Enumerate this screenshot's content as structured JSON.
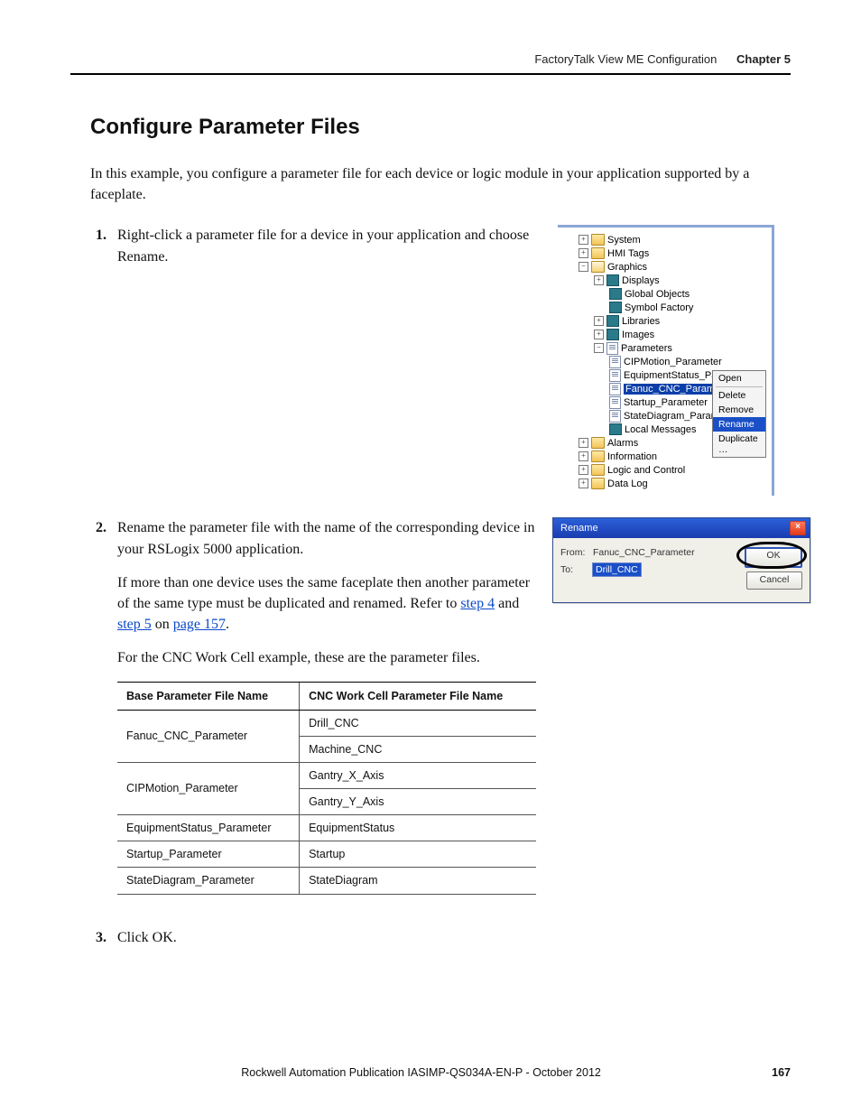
{
  "header": {
    "chapter_title": "FactoryTalk View ME Configuration",
    "chapter_label": "Chapter 5"
  },
  "section_title": "Configure Parameter Files",
  "intro": "In this example, you configure a parameter file for each device or logic module in your application supported by a faceplate.",
  "steps": {
    "s1": {
      "num": "1.",
      "text": "Right-click a parameter file for a device in your application and choose Rename."
    },
    "s2": {
      "num": "2.",
      "p1": "Rename the parameter file with the name of the corresponding device in your RSLogix 5000 application.",
      "p2a": "If more than one device uses the same faceplate then another parameter of the same type must be duplicated and renamed. Refer to ",
      "link1": "step 4",
      "p2b": " and ",
      "link2": "step 5",
      "p2c": " on ",
      "link3": "page 157",
      "p2d": ".",
      "p3": "For the CNC Work Cell example, these are the parameter files."
    },
    "s3": {
      "num": "3.",
      "text": "Click OK."
    }
  },
  "table": {
    "h1": "Base Parameter File Name",
    "h2": "CNC Work Cell Parameter File Name",
    "rows": [
      {
        "c1": "Fanuc_CNC_Parameter",
        "c2": "Drill_CNC"
      },
      {
        "c1": "",
        "c2": "Machine_CNC"
      },
      {
        "c1": "CIPMotion_Parameter",
        "c2": "Gantry_X_Axis"
      },
      {
        "c1": "",
        "c2": "Gantry_Y_Axis"
      },
      {
        "c1": "EquipmentStatus_Parameter",
        "c2": "EquipmentStatus"
      },
      {
        "c1": "Startup_Parameter",
        "c2": "Startup"
      },
      {
        "c1": "StateDiagram_Parameter",
        "c2": "StateDiagram"
      }
    ]
  },
  "tree": {
    "system": "System",
    "hmi": "HMI Tags",
    "graphics": "Graphics",
    "displays": "Displays",
    "global_objects": "Global Objects",
    "symbol_factory": "Symbol Factory",
    "libraries": "Libraries",
    "images": "Images",
    "parameters": "Parameters",
    "p_cip": "CIPMotion_Parameter",
    "p_eq": "EquipmentStatus_Parameter",
    "p_fanuc": "Fanuc_CNC_Parameter",
    "p_startup": "Startup_Parameter",
    "p_state": "StateDiagram_Parameter",
    "local_msgs": "Local Messages",
    "alarms": "Alarms",
    "information": "Information",
    "logic": "Logic and Control",
    "datalog": "Data Log"
  },
  "context_menu": {
    "open": "Open",
    "delete": "Delete",
    "remove": "Remove",
    "rename": "Rename",
    "duplicate": "Duplicate …"
  },
  "dialog": {
    "title": "Rename",
    "from_label": "From:",
    "from_value": "Fanuc_CNC_Parameter",
    "to_label": "To:",
    "to_value": "Drill_CNC",
    "ok": "OK",
    "cancel": "Cancel"
  },
  "footer": {
    "pub_a": "Rockwell Automation Publication IASIMP-QS034A-EN-P - ",
    "pub_b": "October 2012",
    "page": "167"
  }
}
